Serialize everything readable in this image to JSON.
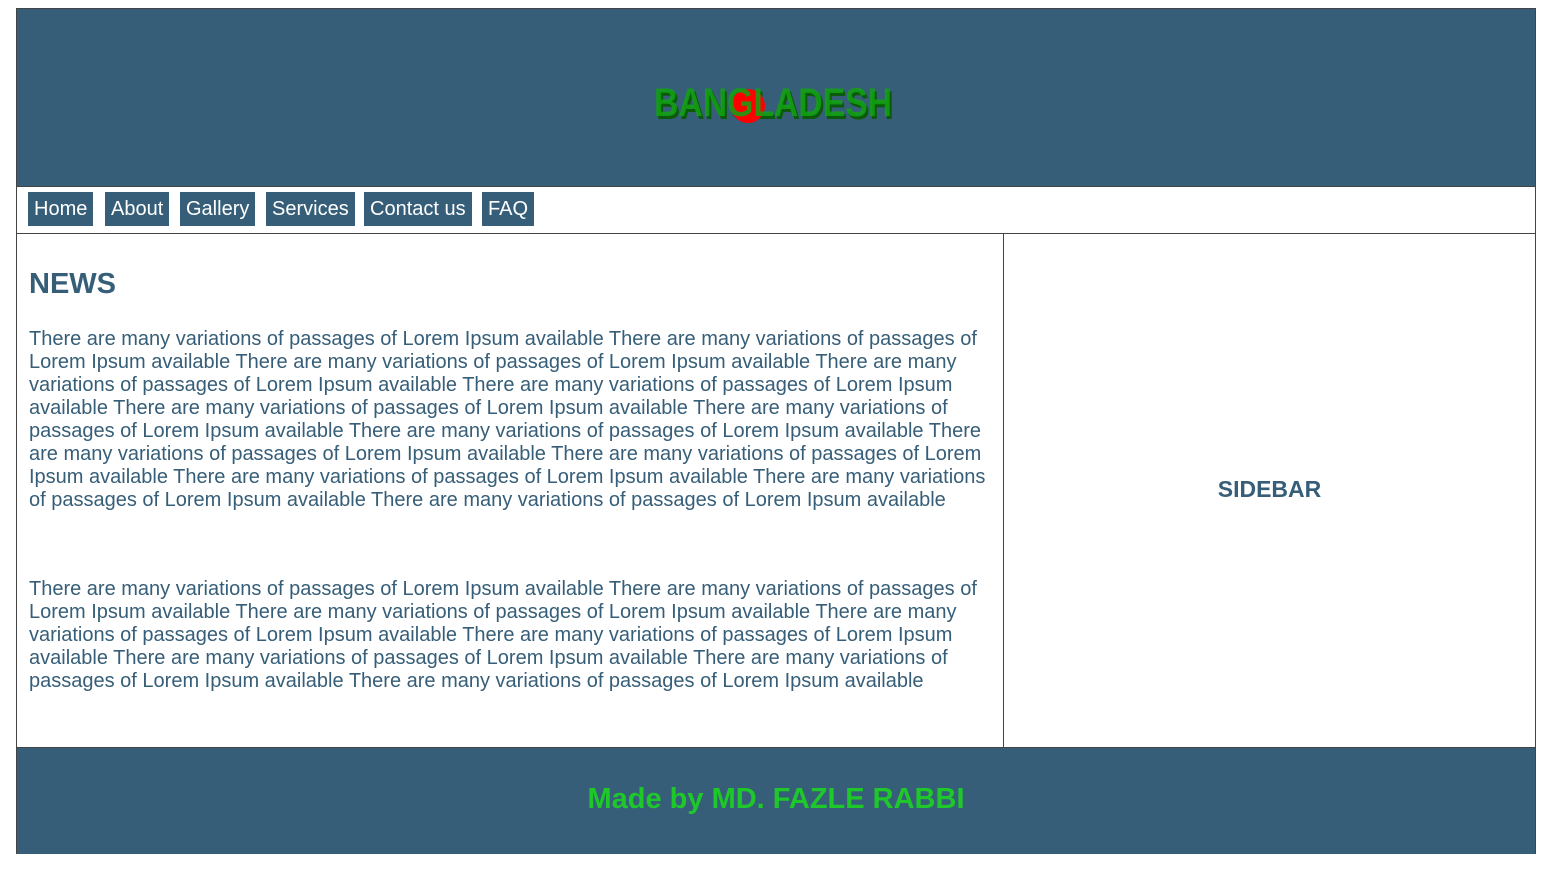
{
  "header": {
    "logo_text": "BANGLADESH"
  },
  "nav": {
    "items": [
      {
        "label": "Home"
      },
      {
        "label": "About"
      },
      {
        "label": "Gallery"
      },
      {
        "label": "Services"
      },
      {
        "label": "Contact us"
      },
      {
        "label": "FAQ"
      }
    ]
  },
  "main": {
    "title": "NEWS",
    "paragraphs": [
      "There are many variations of passages of Lorem Ipsum available There are many variations of passages of Lorem Ipsum available There are many variations of passages of Lorem Ipsum available There are many variations of passages of Lorem Ipsum available There are many variations of passages of Lorem Ipsum available There are many variations of passages of Lorem Ipsum available There are many variations of passages of Lorem Ipsum available There are many variations of passages of Lorem Ipsum available There are many variations of passages of Lorem Ipsum available There are many variations of passages of Lorem Ipsum available There are many variations of passages of Lorem Ipsum available There are many variations of passages of Lorem Ipsum available There are many variations of passages of Lorem Ipsum available",
      "There are many variations of passages of Lorem Ipsum available There are many variations of passages of Lorem Ipsum available There are many variations of passages of Lorem Ipsum available There are many variations of passages of Lorem Ipsum available There are many variations of passages of Lorem Ipsum available There are many variations of passages of Lorem Ipsum available There are many variations of passages of Lorem Ipsum available There are many variations of passages of Lorem Ipsum available"
    ]
  },
  "sidebar": {
    "title": "SIDEBAR"
  },
  "footer": {
    "text": "Made by MD. FAZLE RABBI"
  },
  "colors": {
    "primary": "#365e78",
    "footer_text": "#1fc82a",
    "logo_green": "#12a312",
    "logo_red": "#ff0000"
  }
}
